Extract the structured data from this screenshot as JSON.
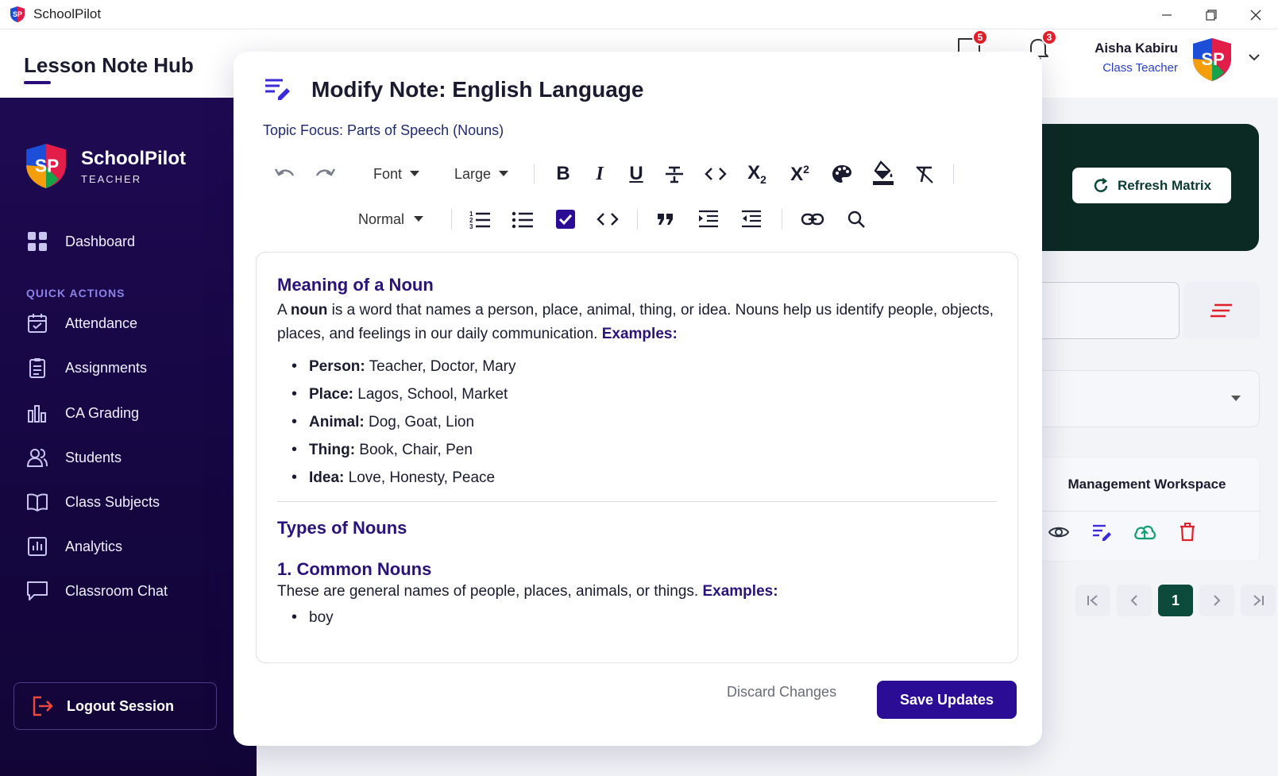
{
  "window": {
    "app_name": "SchoolPilot"
  },
  "header": {
    "title": "Lesson Note Hub",
    "messages_badge": "5",
    "notifications_badge": "3",
    "user_name": "Aisha Kabiru",
    "user_role": "Class Teacher"
  },
  "sidebar": {
    "brand_name": "SchoolPilot",
    "brand_sub": "TEACHER",
    "dashboard": "Dashboard",
    "section_label": "QUICK ACTIONS",
    "items": [
      "Attendance",
      "Assignments",
      "CA Grading",
      "Students",
      "Class Subjects",
      "Analytics",
      "Classroom Chat"
    ],
    "logout": "Logout Session"
  },
  "background": {
    "refresh_label": "Refresh Matrix",
    "table_header": "Management Workspace",
    "current_page": "1"
  },
  "modal": {
    "title": "Modify Note: English Language",
    "topic": "Topic Focus: Parts of Speech (Nouns)",
    "toolbar": {
      "font": "Font",
      "size": "Large",
      "block": "Normal"
    },
    "content": {
      "h1": "Meaning of a Noun",
      "p1_a": "A ",
      "p1_bold": "noun",
      "p1_b": " is a word that names a person, place, animal, thing, or idea. Nouns help us identify people, objects, places, and feelings in our daily communication. ",
      "examples": "Examples:",
      "list": [
        {
          "label": "Person:",
          "text": " Teacher, Doctor, Mary"
        },
        {
          "label": "Place:",
          "text": " Lagos, School, Market"
        },
        {
          "label": "Animal:",
          "text": " Dog, Goat, Lion"
        },
        {
          "label": "Thing:",
          "text": " Book, Chair, Pen"
        },
        {
          "label": "Idea:",
          "text": " Love, Honesty, Peace"
        }
      ],
      "h2": "Types of Nouns",
      "h3": "1. Common Nouns",
      "p2": "These are general names of people, places, animals, or things. ",
      "examples2": "Examples:",
      "list2": [
        "boy"
      ]
    },
    "discard_label": "Discard Changes",
    "save_label": "Save Updates"
  },
  "colors": {
    "primary": "#2a0d94",
    "sidebar": "#1e0a52",
    "dark_card": "#0c2a24",
    "badge": "#e0202b"
  }
}
